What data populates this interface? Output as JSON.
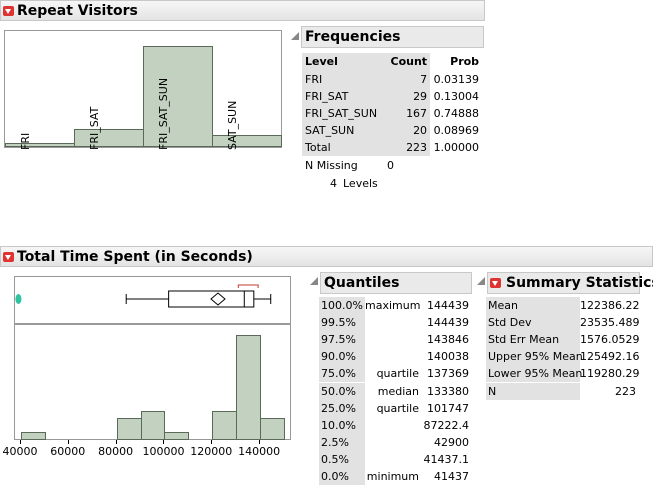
{
  "repeat": {
    "title": "Repeat Visitors",
    "chart_data": {
      "type": "bar",
      "categories": [
        "FRI",
        "FRI_SAT",
        "FRI_SAT_SUN",
        "SAT_SUN"
      ],
      "values": [
        7,
        29,
        167,
        20
      ]
    },
    "frequencies": {
      "title": "Frequencies",
      "headers": [
        "Level",
        "Count",
        "Prob"
      ],
      "rows": [
        {
          "level": "FRI",
          "count": "7",
          "prob": "0.03139"
        },
        {
          "level": "FRI_SAT",
          "count": "29",
          "prob": "0.13004"
        },
        {
          "level": "FRI_SAT_SUN",
          "count": "167",
          "prob": "0.74888"
        },
        {
          "level": "SAT_SUN",
          "count": "20",
          "prob": "0.08969"
        },
        {
          "level": "Total",
          "count": "223",
          "prob": "1.00000"
        }
      ],
      "n_missing_label": "N Missing",
      "n_missing_value": "0",
      "levels_count": "4",
      "levels_label": "Levels"
    }
  },
  "time": {
    "title": "Total Time Spent (in Seconds)",
    "chart_data": {
      "type": "bar",
      "bins": [
        40000,
        50000,
        60000,
        70000,
        80000,
        90000,
        100000,
        110000,
        120000,
        130000,
        140000,
        150000
      ],
      "values": [
        1,
        0,
        0,
        0,
        3,
        4,
        1,
        0,
        4,
        15,
        3
      ],
      "xticks": [
        "40000",
        "60000",
        "80000",
        "100000",
        "120000",
        "140000"
      ],
      "xlim": [
        37500,
        152500
      ]
    },
    "quantiles": {
      "title": "Quantiles",
      "rows": [
        {
          "pct": "100.0%",
          "label": "maximum",
          "value": "144439"
        },
        {
          "pct": "99.5%",
          "label": "",
          "value": "144439"
        },
        {
          "pct": "97.5%",
          "label": "",
          "value": "143846"
        },
        {
          "pct": "90.0%",
          "label": "",
          "value": "140038"
        },
        {
          "pct": "75.0%",
          "label": "quartile",
          "value": "137369"
        },
        {
          "pct": "50.0%",
          "label": "median",
          "value": "133380"
        },
        {
          "pct": "25.0%",
          "label": "quartile",
          "value": "101747"
        },
        {
          "pct": "10.0%",
          "label": "",
          "value": "87222.4"
        },
        {
          "pct": "2.5%",
          "label": "",
          "value": "42900"
        },
        {
          "pct": "0.5%",
          "label": "",
          "value": "41437.1"
        },
        {
          "pct": "0.0%",
          "label": "minimum",
          "value": "41437"
        }
      ]
    },
    "summary": {
      "title": "Summary Statistics",
      "rows": [
        {
          "label": "Mean",
          "value": "122386.22"
        },
        {
          "label": "Std Dev",
          "value": "23535.489"
        },
        {
          "label": "Std Err Mean",
          "value": "1576.0529"
        },
        {
          "label": "Upper 95% Mean",
          "value": "125492.16"
        },
        {
          "label": "Lower 95% Mean",
          "value": "119280.29"
        },
        {
          "label": "N",
          "value": "223"
        }
      ]
    }
  }
}
